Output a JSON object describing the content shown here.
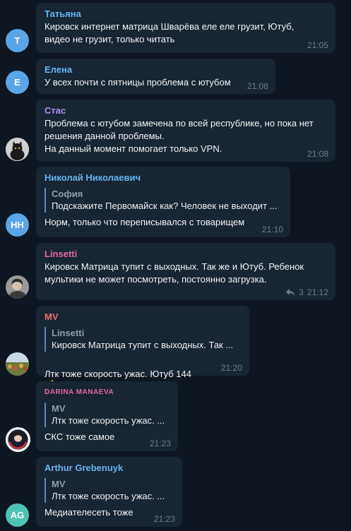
{
  "messages": [
    {
      "sender": "Татьяна",
      "sender_color": "#64b5ef",
      "avatar": {
        "letter": "Т",
        "bg": "#5aa5e6"
      },
      "text": "Кировск интернет матрица Шварёва еле еле грузит, Ютуб,\nвидео не грузит, только читать",
      "time": "21:05"
    },
    {
      "sender": "Елена",
      "sender_color": "#64b5ef",
      "avatar": {
        "letter": "Е",
        "bg": "#5aa5e6"
      },
      "text": "У всех почти с пятницы проблема с ютубом",
      "time": "21:08"
    },
    {
      "sender": "Стас",
      "sender_color": "#b28cef",
      "avatar": {
        "letter": "",
        "bg": "#c9c9c9",
        "kind": "cat-photo"
      },
      "text": "Проблема с ютубом замечена по всей республике, но пока нет\nрешения данной проблемы.\nНа данный момент помогает только VPN.",
      "time": "21:08"
    },
    {
      "sender": "Николай Николаевич",
      "sender_color": "#64b5ef",
      "avatar": {
        "letter": "НН",
        "bg": "#5aa5e6"
      },
      "reply": {
        "name": "София",
        "text": "Подскажите Первомайск как? Человек не выходит ..."
      },
      "text": "Норм, только что переписывался с товарищем",
      "time": "21:10"
    },
    {
      "sender": "Linsetti",
      "sender_color": "#e06a9b",
      "avatar": {
        "letter": "",
        "bg": "#8a8a8a",
        "kind": "person-photo"
      },
      "text": "Кировск Матрица тупит с выходных. Так же и Ютуб. Ребенок\nмультики не может посмотреть, постоянно загрузка.",
      "replies_count": "3",
      "time": "21:12"
    },
    {
      "sender": "MV",
      "sender_color": "#e8706a",
      "avatar": {
        "letter": "",
        "bg": "#6e7b4c",
        "kind": "landscape-photo"
      },
      "reply": {
        "name": "Linsetti",
        "text": "Кировск Матрица тупит с выходных. Так ..."
      },
      "text": "Лтк тоже скорость ужас. Ютуб 144",
      "emoji": "👍",
      "time": "21:20"
    },
    {
      "sender": "DARINA MANAEVA",
      "sender_color": "#e06a9b",
      "avatar": {
        "letter": "",
        "bg": "#ffffff",
        "kind": "girl-photo"
      },
      "reply": {
        "name": "MV",
        "text": "Лтк тоже скорость ужас. ..."
      },
      "text": "СКС тоже самое",
      "time": "21:23"
    },
    {
      "sender": "Arthur Grebenuyk",
      "sender_color": "#64b5ef",
      "avatar": {
        "letter": "AG",
        "bg": "#4fc3b4"
      },
      "reply": {
        "name": "MV",
        "text": "Лтк тоже скорость ужас. ..."
      },
      "text": "Медиателесеть тоже",
      "time": "21:23"
    }
  ]
}
